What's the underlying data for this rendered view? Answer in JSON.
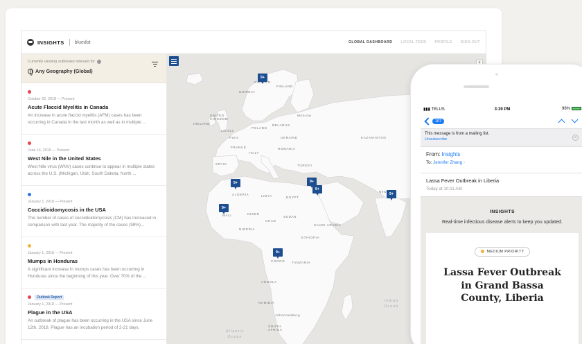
{
  "dashboard": {
    "brand": "INSIGHTS",
    "partner": "bluedot",
    "nav": [
      "GLOBAL DASHBOARD",
      "LOCAL FEED",
      "PROFILE",
      "SIGN OUT"
    ],
    "geo_caption": "Currently viewing outbreaks relevant for",
    "geo_value": "Any Geography (Global)",
    "items": [
      {
        "color": "#e8444e",
        "tag": "",
        "date": "October 22, 2018 — Present",
        "title": "Acute Flaccid Myelitis in Canada",
        "desc": "An increase in acute flaccid myelitis (AFM) cases has been occurring in Canada in the last month as well as in multiple ..."
      },
      {
        "color": "#e8444e",
        "tag": "",
        "date": "June 14, 2019 — Present",
        "title": "West Nile in the United States",
        "desc": "West Nile virus (WNV) cases continue to appear in multiple states across the U.S. (Michigan, Utah, South Dakota, North ..."
      },
      {
        "color": "#2b78e4",
        "tag": "",
        "date": "January 1, 2018 — Present",
        "title": "Coccidioidomycosis in the USA",
        "desc": "The number of cases of coccidioidomycosis (CM) has increased in comparison with last year. The majority of the cases (98%)..."
      },
      {
        "color": "#f0b43a",
        "tag": "",
        "date": "January 1, 2018 — Present",
        "title": "Mumps in Honduras",
        "desc": "A significant increase in mumps cases has been occurring in Honduras since the beginning of this year. Over 70% of the ..."
      },
      {
        "color": "#e8444e",
        "tag": "Outlook Report",
        "date": "January 1, 2018 — Present",
        "title": "Plague in the USA",
        "desc": "An outbreak of plague has been occurring in the USA since June 12th, 2018. Plague has an incubation period of 2-21 days."
      }
    ],
    "map": {
      "zoom_label": "+",
      "places": [
        "NORWAY",
        "SWEDEN",
        "FINLAND",
        "UNITED KINGDOM",
        "IRELAND",
        "London",
        "Paris",
        "FRANCE",
        "SPAIN",
        "BELARUS",
        "POLAND",
        "UKRAINE",
        "ITALY",
        "ROMANIA",
        "TURKEY",
        "Moscow",
        "KAZAKHSTAN",
        "ALGERIA",
        "LIBYA",
        "EGYPT",
        "SAUDI ARABIA",
        "New",
        "MALI",
        "NIGER",
        "CHAD",
        "SUDAN",
        "NIGERIA",
        "ETHIOPIA",
        "CONGO",
        "TANZANIA",
        "ANGOLA",
        "NAMIBIA",
        "Johannesburg",
        "SOUTH AFRICA"
      ],
      "oceans": [
        "Atlantic Ocean",
        "Indian Ocean"
      ],
      "marker_label": "9+"
    }
  },
  "phone": {
    "carrier": "TELUS",
    "time": "3:39 PM",
    "battery": "98%",
    "unread_badge": "107",
    "banner_text": "This message is from a mailing list.",
    "banner_link": "Unsubscribe",
    "from_label": "From:",
    "from_name": "Insights",
    "to_label": "To:",
    "to_name": "Jennifer Zhang",
    "subject": "Lassa Fever Outbreak in Liberia",
    "datetime": "Today at 10:11 AM",
    "body_brand": "INSIGHTS",
    "tagline": "Real-time infectious disease alerts to keep you updated.",
    "priority": "MEDIUM PRIORITY",
    "headline": "Lassa Fever Outbreak in Grand Bassa County, Liberia"
  }
}
